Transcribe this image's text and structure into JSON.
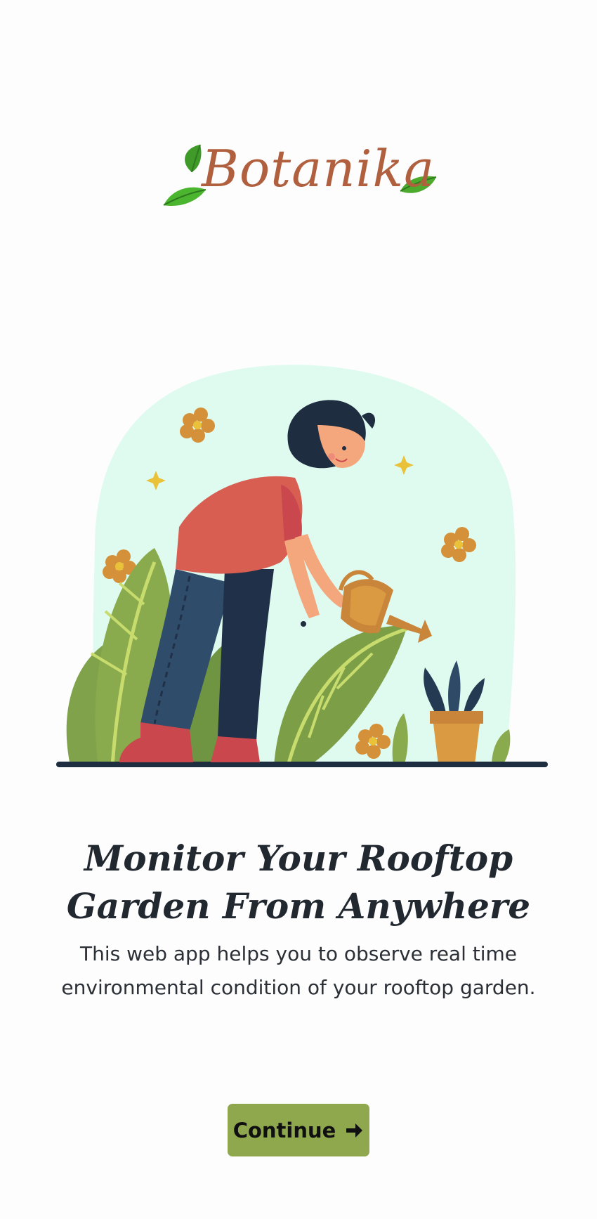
{
  "brand": {
    "name": "Botanika",
    "icon": "leaf-icon"
  },
  "hero": {
    "illustration": "gardener-watering-plant"
  },
  "headline": {
    "line1": "Monitor Your Rooftop",
    "line2": "Garden From Anywhere"
  },
  "description": {
    "line1": "This web app helps you to observe real time",
    "line2": "environmental condition of your rooftop garden."
  },
  "actions": {
    "continue_label": "Continue",
    "continue_icon": "arrow-right-icon"
  },
  "colors": {
    "brand_text": "#b0603e",
    "leaf_green": "#4caa2d",
    "button_bg": "#8fa84d",
    "heading": "#222830",
    "blob": "#dffbf0"
  }
}
